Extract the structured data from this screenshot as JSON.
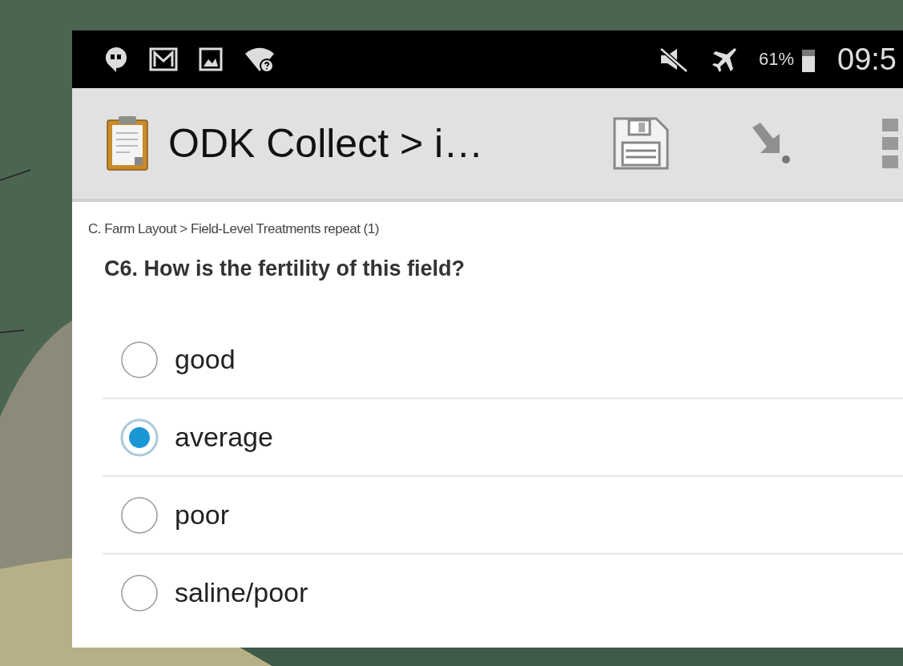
{
  "status_bar": {
    "battery": "61%",
    "time": "09:5"
  },
  "toolbar": {
    "title": "ODK Collect > i…"
  },
  "breadcrumb": "C. Farm Layout > Field-Level Treatments repeat (1)",
  "question": {
    "label": "C6. How is the fertility of this field?",
    "options": [
      {
        "label": "good",
        "selected": false
      },
      {
        "label": "average",
        "selected": true
      },
      {
        "label": "poor",
        "selected": false
      },
      {
        "label": "saline/poor",
        "selected": false
      }
    ]
  }
}
